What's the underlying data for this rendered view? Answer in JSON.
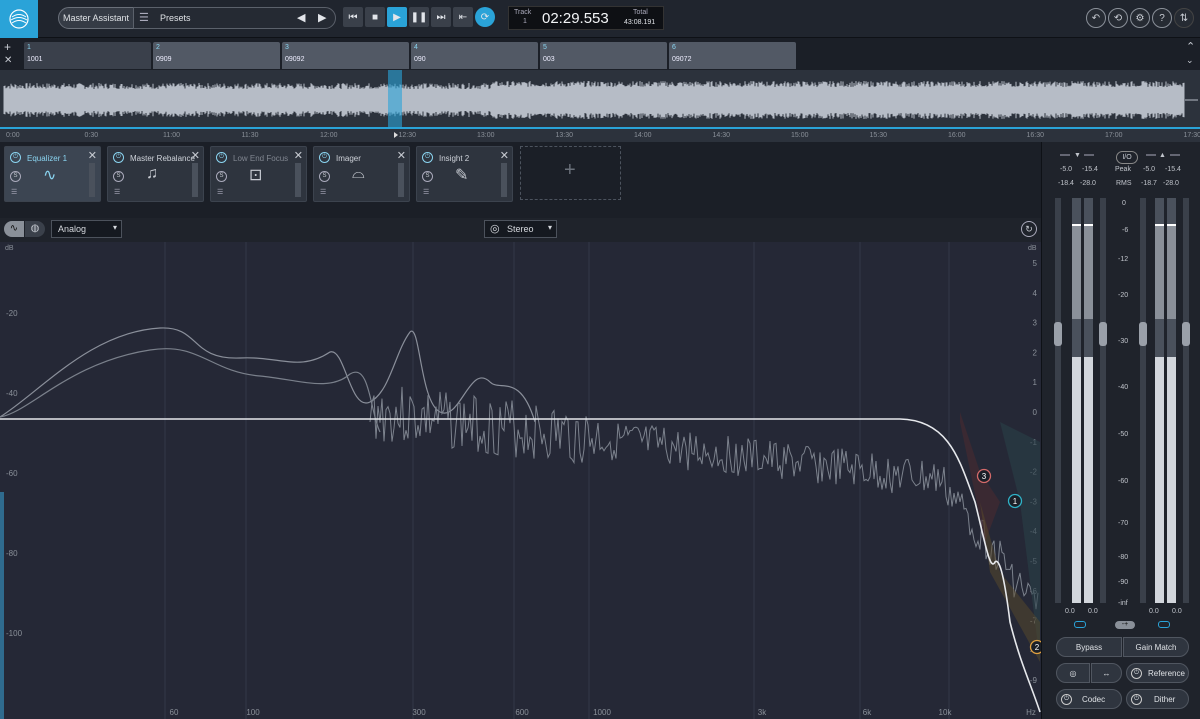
{
  "topbar": {
    "logo": "izotope-logo-icon",
    "assistant_label": "Master Assistant",
    "presets_label": "Presets",
    "track_label": "Track",
    "track_number": "1",
    "time": "02:29.553",
    "total_label": "Total",
    "total_time": "43:08.191"
  },
  "tracks": [
    {
      "num": "1",
      "name": "1001"
    },
    {
      "num": "2",
      "name": "0909"
    },
    {
      "num": "3",
      "name": "09092"
    },
    {
      "num": "4",
      "name": "090"
    },
    {
      "num": "5",
      "name": "003"
    },
    {
      "num": "6",
      "name": "09072"
    }
  ],
  "timeline": [
    "0:00",
    "0:30",
    "11:00",
    "11:30",
    "12:00",
    "12:30",
    "13:00",
    "13:30",
    "14:00",
    "14:30",
    "15:00",
    "15:30",
    "16:00",
    "16:30",
    "17:00",
    "17:30"
  ],
  "playhead_fraction": 0.33,
  "modules": [
    {
      "name": "Equalizer 1",
      "icon": "eq-curve-icon",
      "active": true
    },
    {
      "name": "Master Rebalance",
      "icon": "music-note-icon",
      "active": false
    },
    {
      "name": "Low End Focus",
      "icon": "target-icon",
      "active": false
    },
    {
      "name": "Imager",
      "icon": "stereo-arc-icon",
      "active": false
    },
    {
      "name": "Insight 2",
      "icon": "insight-icon",
      "active": false
    }
  ],
  "eq": {
    "mode": "Analog",
    "channel": "Stereo",
    "left_db_label": "dB",
    "left_axis": [
      "-20",
      "-40",
      "-60",
      "-80",
      "-100"
    ],
    "right_db_label": "dB",
    "right_axis": [
      "5",
      "4",
      "3",
      "2",
      "1",
      "0",
      "-1",
      "-2",
      "-3",
      "-4",
      "-5",
      "-6",
      "-7",
      "-8",
      "-9"
    ],
    "freq_axis": [
      "60",
      "100",
      "300",
      "600",
      "1000",
      "3k",
      "6k",
      "10k",
      "Hz"
    ],
    "nodes": [
      "1",
      "2",
      "3"
    ]
  },
  "meters": {
    "io_label": "I/O",
    "in_peak": [
      "-5.0",
      "-15.4"
    ],
    "in_rms": [
      "-18.4",
      "-28.0"
    ],
    "out_peak": [
      "-5.0",
      "-15.4"
    ],
    "out_rms": [
      "-18.7",
      "-28.0"
    ],
    "peak_label": "Peak",
    "rms_label": "RMS",
    "scale": [
      "0",
      "-6",
      "-12",
      "-20",
      "-30",
      "-40",
      "-50",
      "-60",
      "-70",
      "-80",
      "-90",
      "-inf"
    ],
    "bottom_in": [
      "0.0",
      "0.0"
    ],
    "bottom_out": [
      "0.0",
      "0.0"
    ],
    "bypass": "Bypass",
    "gain_match": "Gain Match",
    "reference": "Reference",
    "codec": "Codec",
    "dither": "Dither"
  }
}
